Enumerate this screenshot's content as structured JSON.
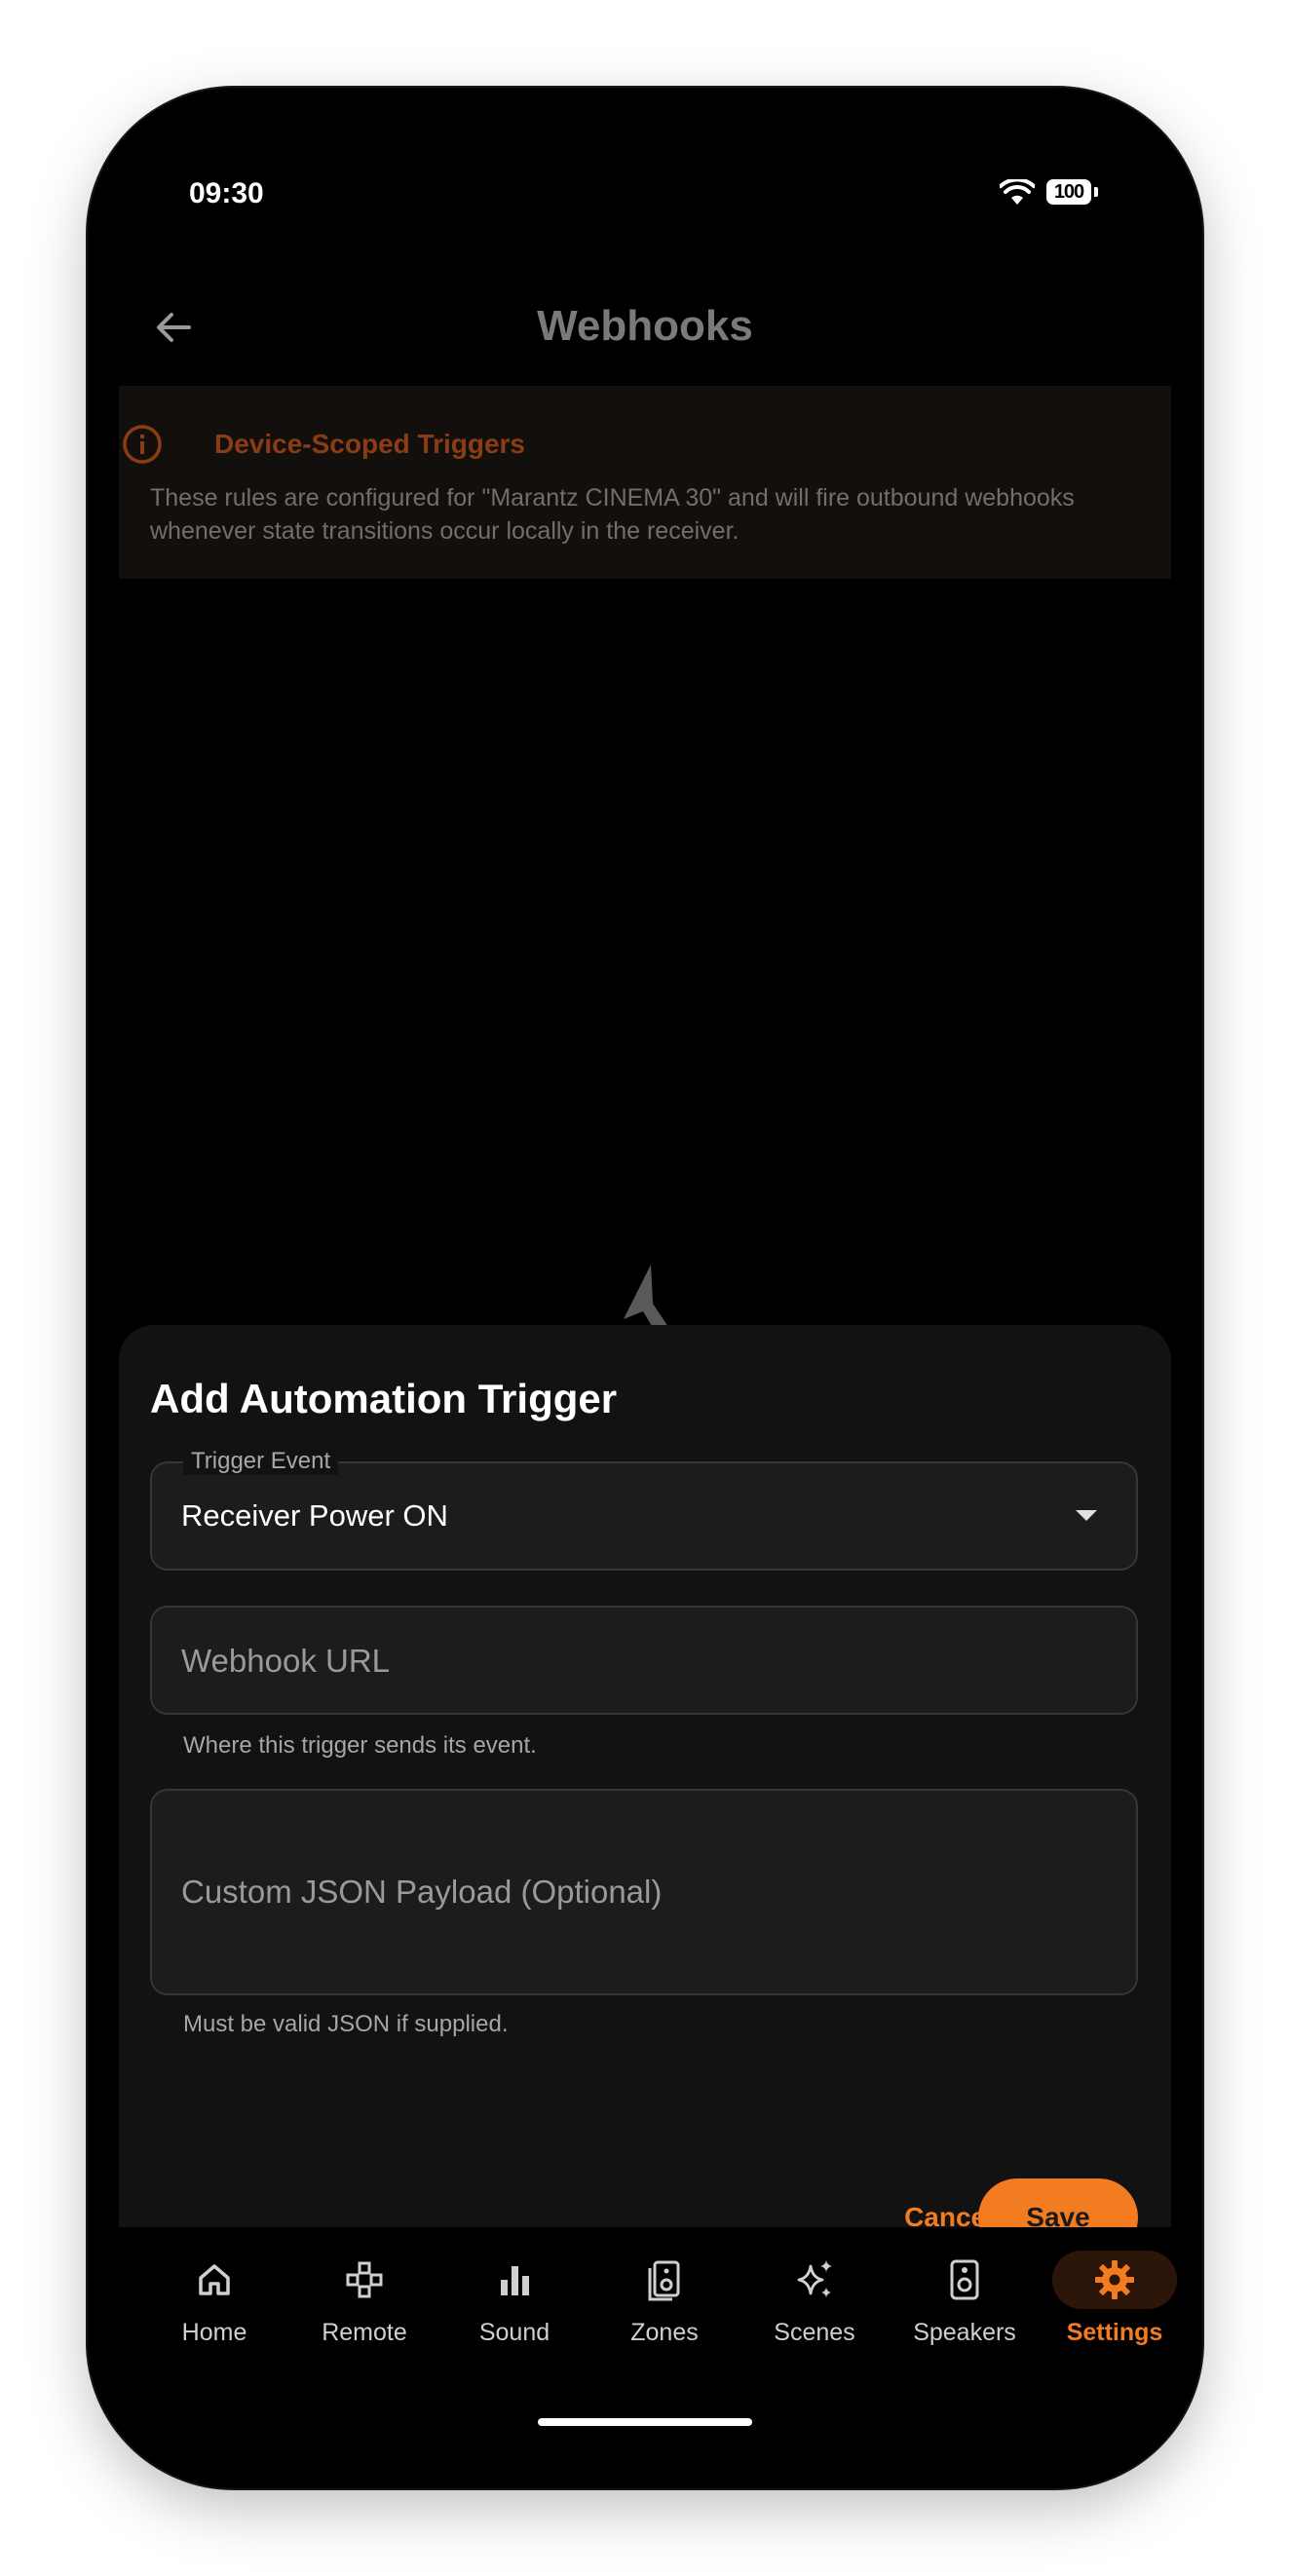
{
  "status_bar": {
    "time": "09:30",
    "battery": "100"
  },
  "header": {
    "title": "Webhooks"
  },
  "banner": {
    "title": "Device-Scoped Triggers",
    "text": "These rules are configured for \"Marantz CINEMA 30\" and will fire outbound webhooks whenever state transitions occur locally in the receiver."
  },
  "sheet": {
    "title": "Add Automation Trigger",
    "trigger_event": {
      "label": "Trigger Event",
      "value": "Receiver Power ON"
    },
    "webhook_url": {
      "placeholder": "Webhook URL",
      "helper": "Where this trigger sends its event."
    },
    "payload": {
      "placeholder": "Custom JSON Payload (Optional)",
      "helper": "Must be valid JSON if supplied."
    },
    "cancel_label": "Cancel",
    "save_label": "Save"
  },
  "nav": {
    "items": [
      {
        "label": "Home",
        "icon": "home-icon"
      },
      {
        "label": "Remote",
        "icon": "remote-icon"
      },
      {
        "label": "Sound",
        "icon": "equalizer-icon"
      },
      {
        "label": "Zones",
        "icon": "zones-speaker-icon"
      },
      {
        "label": "Scenes",
        "icon": "sparkle-icon"
      },
      {
        "label": "Speakers",
        "icon": "speaker-icon"
      },
      {
        "label": "Settings",
        "icon": "gear-icon",
        "active": true
      }
    ]
  },
  "colors": {
    "accent": "#f47c20",
    "banner_title": "#8a3d14",
    "background": "#000000",
    "sheet": "#121212"
  }
}
